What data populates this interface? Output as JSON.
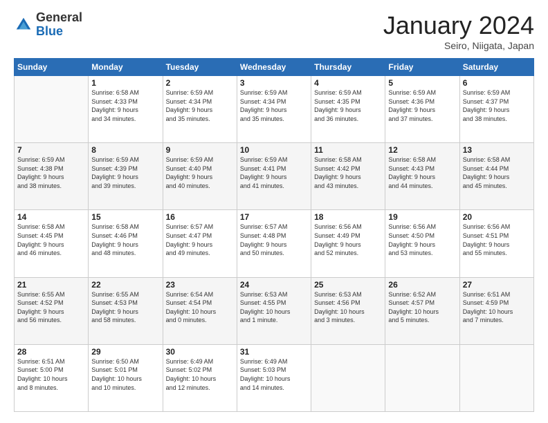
{
  "header": {
    "logo_general": "General",
    "logo_blue": "Blue",
    "month_title": "January 2024",
    "location": "Seiro, Niigata, Japan"
  },
  "weekdays": [
    "Sunday",
    "Monday",
    "Tuesday",
    "Wednesday",
    "Thursday",
    "Friday",
    "Saturday"
  ],
  "weeks": [
    [
      {
        "day": "",
        "info": ""
      },
      {
        "day": "1",
        "info": "Sunrise: 6:58 AM\nSunset: 4:33 PM\nDaylight: 9 hours\nand 34 minutes."
      },
      {
        "day": "2",
        "info": "Sunrise: 6:59 AM\nSunset: 4:34 PM\nDaylight: 9 hours\nand 35 minutes."
      },
      {
        "day": "3",
        "info": "Sunrise: 6:59 AM\nSunset: 4:34 PM\nDaylight: 9 hours\nand 35 minutes."
      },
      {
        "day": "4",
        "info": "Sunrise: 6:59 AM\nSunset: 4:35 PM\nDaylight: 9 hours\nand 36 minutes."
      },
      {
        "day": "5",
        "info": "Sunrise: 6:59 AM\nSunset: 4:36 PM\nDaylight: 9 hours\nand 37 minutes."
      },
      {
        "day": "6",
        "info": "Sunrise: 6:59 AM\nSunset: 4:37 PM\nDaylight: 9 hours\nand 38 minutes."
      }
    ],
    [
      {
        "day": "7",
        "info": "Sunrise: 6:59 AM\nSunset: 4:38 PM\nDaylight: 9 hours\nand 38 minutes."
      },
      {
        "day": "8",
        "info": "Sunrise: 6:59 AM\nSunset: 4:39 PM\nDaylight: 9 hours\nand 39 minutes."
      },
      {
        "day": "9",
        "info": "Sunrise: 6:59 AM\nSunset: 4:40 PM\nDaylight: 9 hours\nand 40 minutes."
      },
      {
        "day": "10",
        "info": "Sunrise: 6:59 AM\nSunset: 4:41 PM\nDaylight: 9 hours\nand 41 minutes."
      },
      {
        "day": "11",
        "info": "Sunrise: 6:58 AM\nSunset: 4:42 PM\nDaylight: 9 hours\nand 43 minutes."
      },
      {
        "day": "12",
        "info": "Sunrise: 6:58 AM\nSunset: 4:43 PM\nDaylight: 9 hours\nand 44 minutes."
      },
      {
        "day": "13",
        "info": "Sunrise: 6:58 AM\nSunset: 4:44 PM\nDaylight: 9 hours\nand 45 minutes."
      }
    ],
    [
      {
        "day": "14",
        "info": "Sunrise: 6:58 AM\nSunset: 4:45 PM\nDaylight: 9 hours\nand 46 minutes."
      },
      {
        "day": "15",
        "info": "Sunrise: 6:58 AM\nSunset: 4:46 PM\nDaylight: 9 hours\nand 48 minutes."
      },
      {
        "day": "16",
        "info": "Sunrise: 6:57 AM\nSunset: 4:47 PM\nDaylight: 9 hours\nand 49 minutes."
      },
      {
        "day": "17",
        "info": "Sunrise: 6:57 AM\nSunset: 4:48 PM\nDaylight: 9 hours\nand 50 minutes."
      },
      {
        "day": "18",
        "info": "Sunrise: 6:56 AM\nSunset: 4:49 PM\nDaylight: 9 hours\nand 52 minutes."
      },
      {
        "day": "19",
        "info": "Sunrise: 6:56 AM\nSunset: 4:50 PM\nDaylight: 9 hours\nand 53 minutes."
      },
      {
        "day": "20",
        "info": "Sunrise: 6:56 AM\nSunset: 4:51 PM\nDaylight: 9 hours\nand 55 minutes."
      }
    ],
    [
      {
        "day": "21",
        "info": "Sunrise: 6:55 AM\nSunset: 4:52 PM\nDaylight: 9 hours\nand 56 minutes."
      },
      {
        "day": "22",
        "info": "Sunrise: 6:55 AM\nSunset: 4:53 PM\nDaylight: 9 hours\nand 58 minutes."
      },
      {
        "day": "23",
        "info": "Sunrise: 6:54 AM\nSunset: 4:54 PM\nDaylight: 10 hours\nand 0 minutes."
      },
      {
        "day": "24",
        "info": "Sunrise: 6:53 AM\nSunset: 4:55 PM\nDaylight: 10 hours\nand 1 minute."
      },
      {
        "day": "25",
        "info": "Sunrise: 6:53 AM\nSunset: 4:56 PM\nDaylight: 10 hours\nand 3 minutes."
      },
      {
        "day": "26",
        "info": "Sunrise: 6:52 AM\nSunset: 4:57 PM\nDaylight: 10 hours\nand 5 minutes."
      },
      {
        "day": "27",
        "info": "Sunrise: 6:51 AM\nSunset: 4:59 PM\nDaylight: 10 hours\nand 7 minutes."
      }
    ],
    [
      {
        "day": "28",
        "info": "Sunrise: 6:51 AM\nSunset: 5:00 PM\nDaylight: 10 hours\nand 8 minutes."
      },
      {
        "day": "29",
        "info": "Sunrise: 6:50 AM\nSunset: 5:01 PM\nDaylight: 10 hours\nand 10 minutes."
      },
      {
        "day": "30",
        "info": "Sunrise: 6:49 AM\nSunset: 5:02 PM\nDaylight: 10 hours\nand 12 minutes."
      },
      {
        "day": "31",
        "info": "Sunrise: 6:49 AM\nSunset: 5:03 PM\nDaylight: 10 hours\nand 14 minutes."
      },
      {
        "day": "",
        "info": ""
      },
      {
        "day": "",
        "info": ""
      },
      {
        "day": "",
        "info": ""
      }
    ]
  ]
}
